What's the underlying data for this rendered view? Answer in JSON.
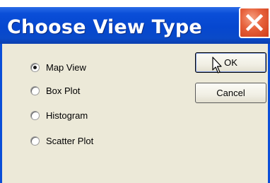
{
  "window": {
    "title": "Choose View Type"
  },
  "options": [
    {
      "label": "Map View",
      "checked": true
    },
    {
      "label": "Box Plot",
      "checked": false
    },
    {
      "label": "Histogram",
      "checked": false
    },
    {
      "label": "Scatter Plot",
      "checked": false
    }
  ],
  "buttons": {
    "ok": "OK",
    "cancel": "Cancel"
  },
  "colors": {
    "titlebar": "#0a4ed8",
    "close": "#e6603a",
    "face": "#ece9d8"
  },
  "icons": {
    "close": "close-icon",
    "cursor": "mouse-cursor-icon"
  }
}
